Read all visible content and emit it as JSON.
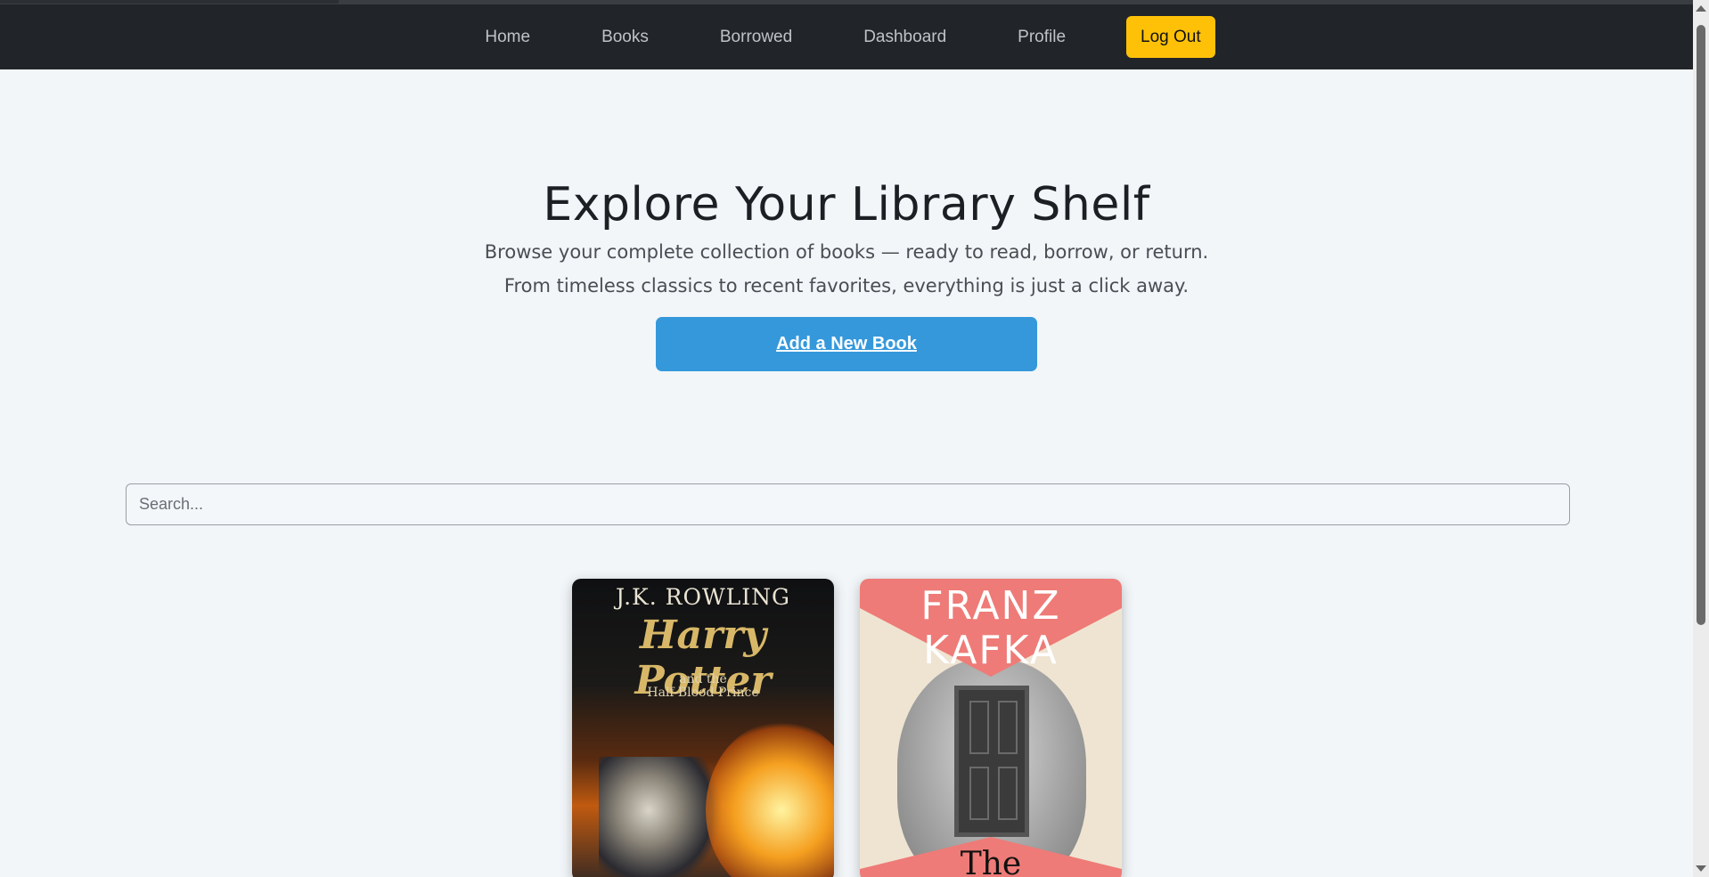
{
  "nav": {
    "links": [
      "Home",
      "Books",
      "Borrowed",
      "Dashboard",
      "Profile"
    ],
    "logout_label": "Log Out"
  },
  "hero": {
    "title": "Explore Your Library Shelf",
    "subtitle_line1": "Browse your complete collection of books — ready to read, borrow, or return.",
    "subtitle_line2": "From timeless classics to recent favorites, everything is just a click away.",
    "add_button_label": "Add a New Book"
  },
  "search": {
    "placeholder": "Search..."
  },
  "books": [
    {
      "cover_author": "J.K. ROWLING",
      "cover_title": "Harry Potter",
      "cover_subtitle_line1": "and the",
      "cover_subtitle_line2": "Half-Blood Prince"
    },
    {
      "cover_author_line1": "FRANZ",
      "cover_author_line2": "KAFKA",
      "cover_title_fragment": "The"
    }
  ],
  "colors": {
    "navbar_bg": "#212529",
    "logout_bg": "#ffc107",
    "add_button_bg": "#3498db",
    "page_bg": "#f2f6f9"
  }
}
